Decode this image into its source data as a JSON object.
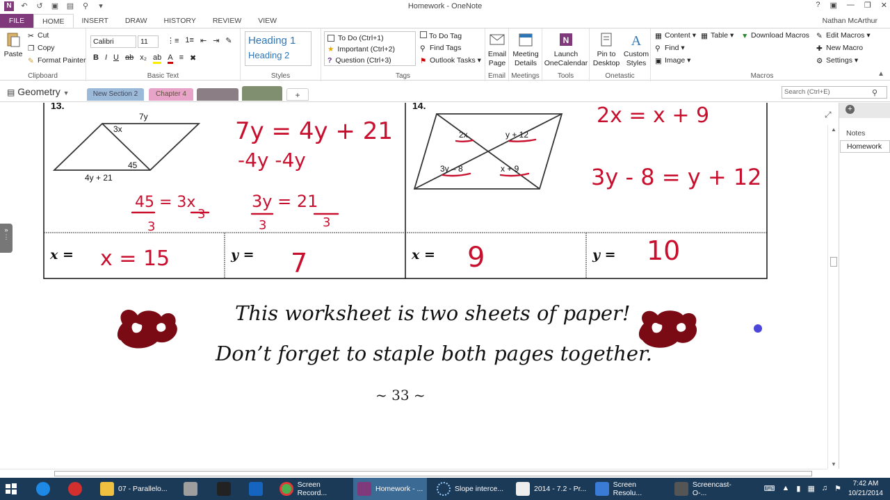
{
  "window": {
    "title": "Homework - OneNote",
    "user": "Nathan McArthur"
  },
  "ribbon_tabs": [
    "FILE",
    "HOME",
    "INSERT",
    "DRAW",
    "HISTORY",
    "REVIEW",
    "VIEW"
  ],
  "clipboard": {
    "paste": "Paste",
    "cut": "Cut",
    "copy": "Copy",
    "format_painter": "Format Painter",
    "label": "Clipboard"
  },
  "basic_text": {
    "font": "Calibri",
    "size": "11",
    "label": "Basic Text",
    "bold": "B",
    "italic": "I",
    "underline": "U"
  },
  "styles": {
    "h1": "Heading 1",
    "h2": "Heading 2",
    "label": "Styles"
  },
  "tags": {
    "items": [
      "To Do (Ctrl+1)",
      "Important (Ctrl+2)",
      "Question (Ctrl+3)"
    ],
    "todo_tag": "To Do Tag",
    "find_tags": "Find Tags",
    "outlook_tasks": "Outlook Tasks",
    "label": "Tags"
  },
  "email": {
    "btn": "Email Page",
    "label": "Email"
  },
  "meetings": {
    "btn": "Meeting Details",
    "label": "Meetings"
  },
  "tools": {
    "btn": "Launch OneCalendar",
    "label": "Tools"
  },
  "onetastic": {
    "pin": "Pin to Desktop",
    "custom": "Custom Styles",
    "label": "Onetastic"
  },
  "macros": {
    "content": "Content",
    "table": "Table",
    "download": "Download Macros",
    "edit": "Edit Macros",
    "find": "Find",
    "new_macro": "New Macro",
    "image": "Image",
    "settings": "Settings",
    "label": "Macros"
  },
  "notebook": {
    "name": "Geometry",
    "sections": [
      "New Section 2",
      "Chapter 4",
      "",
      ""
    ],
    "add": "+"
  },
  "search": {
    "placeholder": "Search (Ctrl+E)"
  },
  "right_panel": {
    "notes": "Notes",
    "page": "Homework"
  },
  "worksheet": {
    "problems": [
      {
        "number": "13.",
        "labels": [
          "7y",
          "3x",
          "45",
          "4y + 21"
        ],
        "x_label": "x =",
        "y_label": "y ="
      },
      {
        "number": "14.",
        "labels": [
          "2x",
          "y + 12",
          "3y – 8",
          "x + 9"
        ],
        "x_label": "x =",
        "y_label": "y ="
      }
    ],
    "handwriting": {
      "p13_eq1": "7y = 4y + 21",
      "p13_eq2": "-4y -4y",
      "p13_eq3": "45 = 3x",
      "p13_eq4": "3y = 21",
      "p13_x": "x = 15",
      "p13_y": "7",
      "p14_eq1": "2x = x + 9",
      "p14_eq2": "3y - 8 = y + 12",
      "p14_x": "9",
      "p14_y": "10"
    },
    "note_line1": "This worksheet is two sheets of paper!",
    "note_line2": "Don’t forget to staple both pages together.",
    "page_number": "~ 33 ~"
  },
  "taskbar": {
    "items": [
      "",
      "",
      "",
      "07 - Parallelo...",
      "",
      "",
      "",
      "Screen Record...",
      "Homework - ...",
      "Slope interce...",
      "2014 - 7.2 - Pr...",
      "Screen Resolu...",
      "Screencast-O-..."
    ],
    "time": "7:42 AM",
    "date": "10/21/2014"
  }
}
